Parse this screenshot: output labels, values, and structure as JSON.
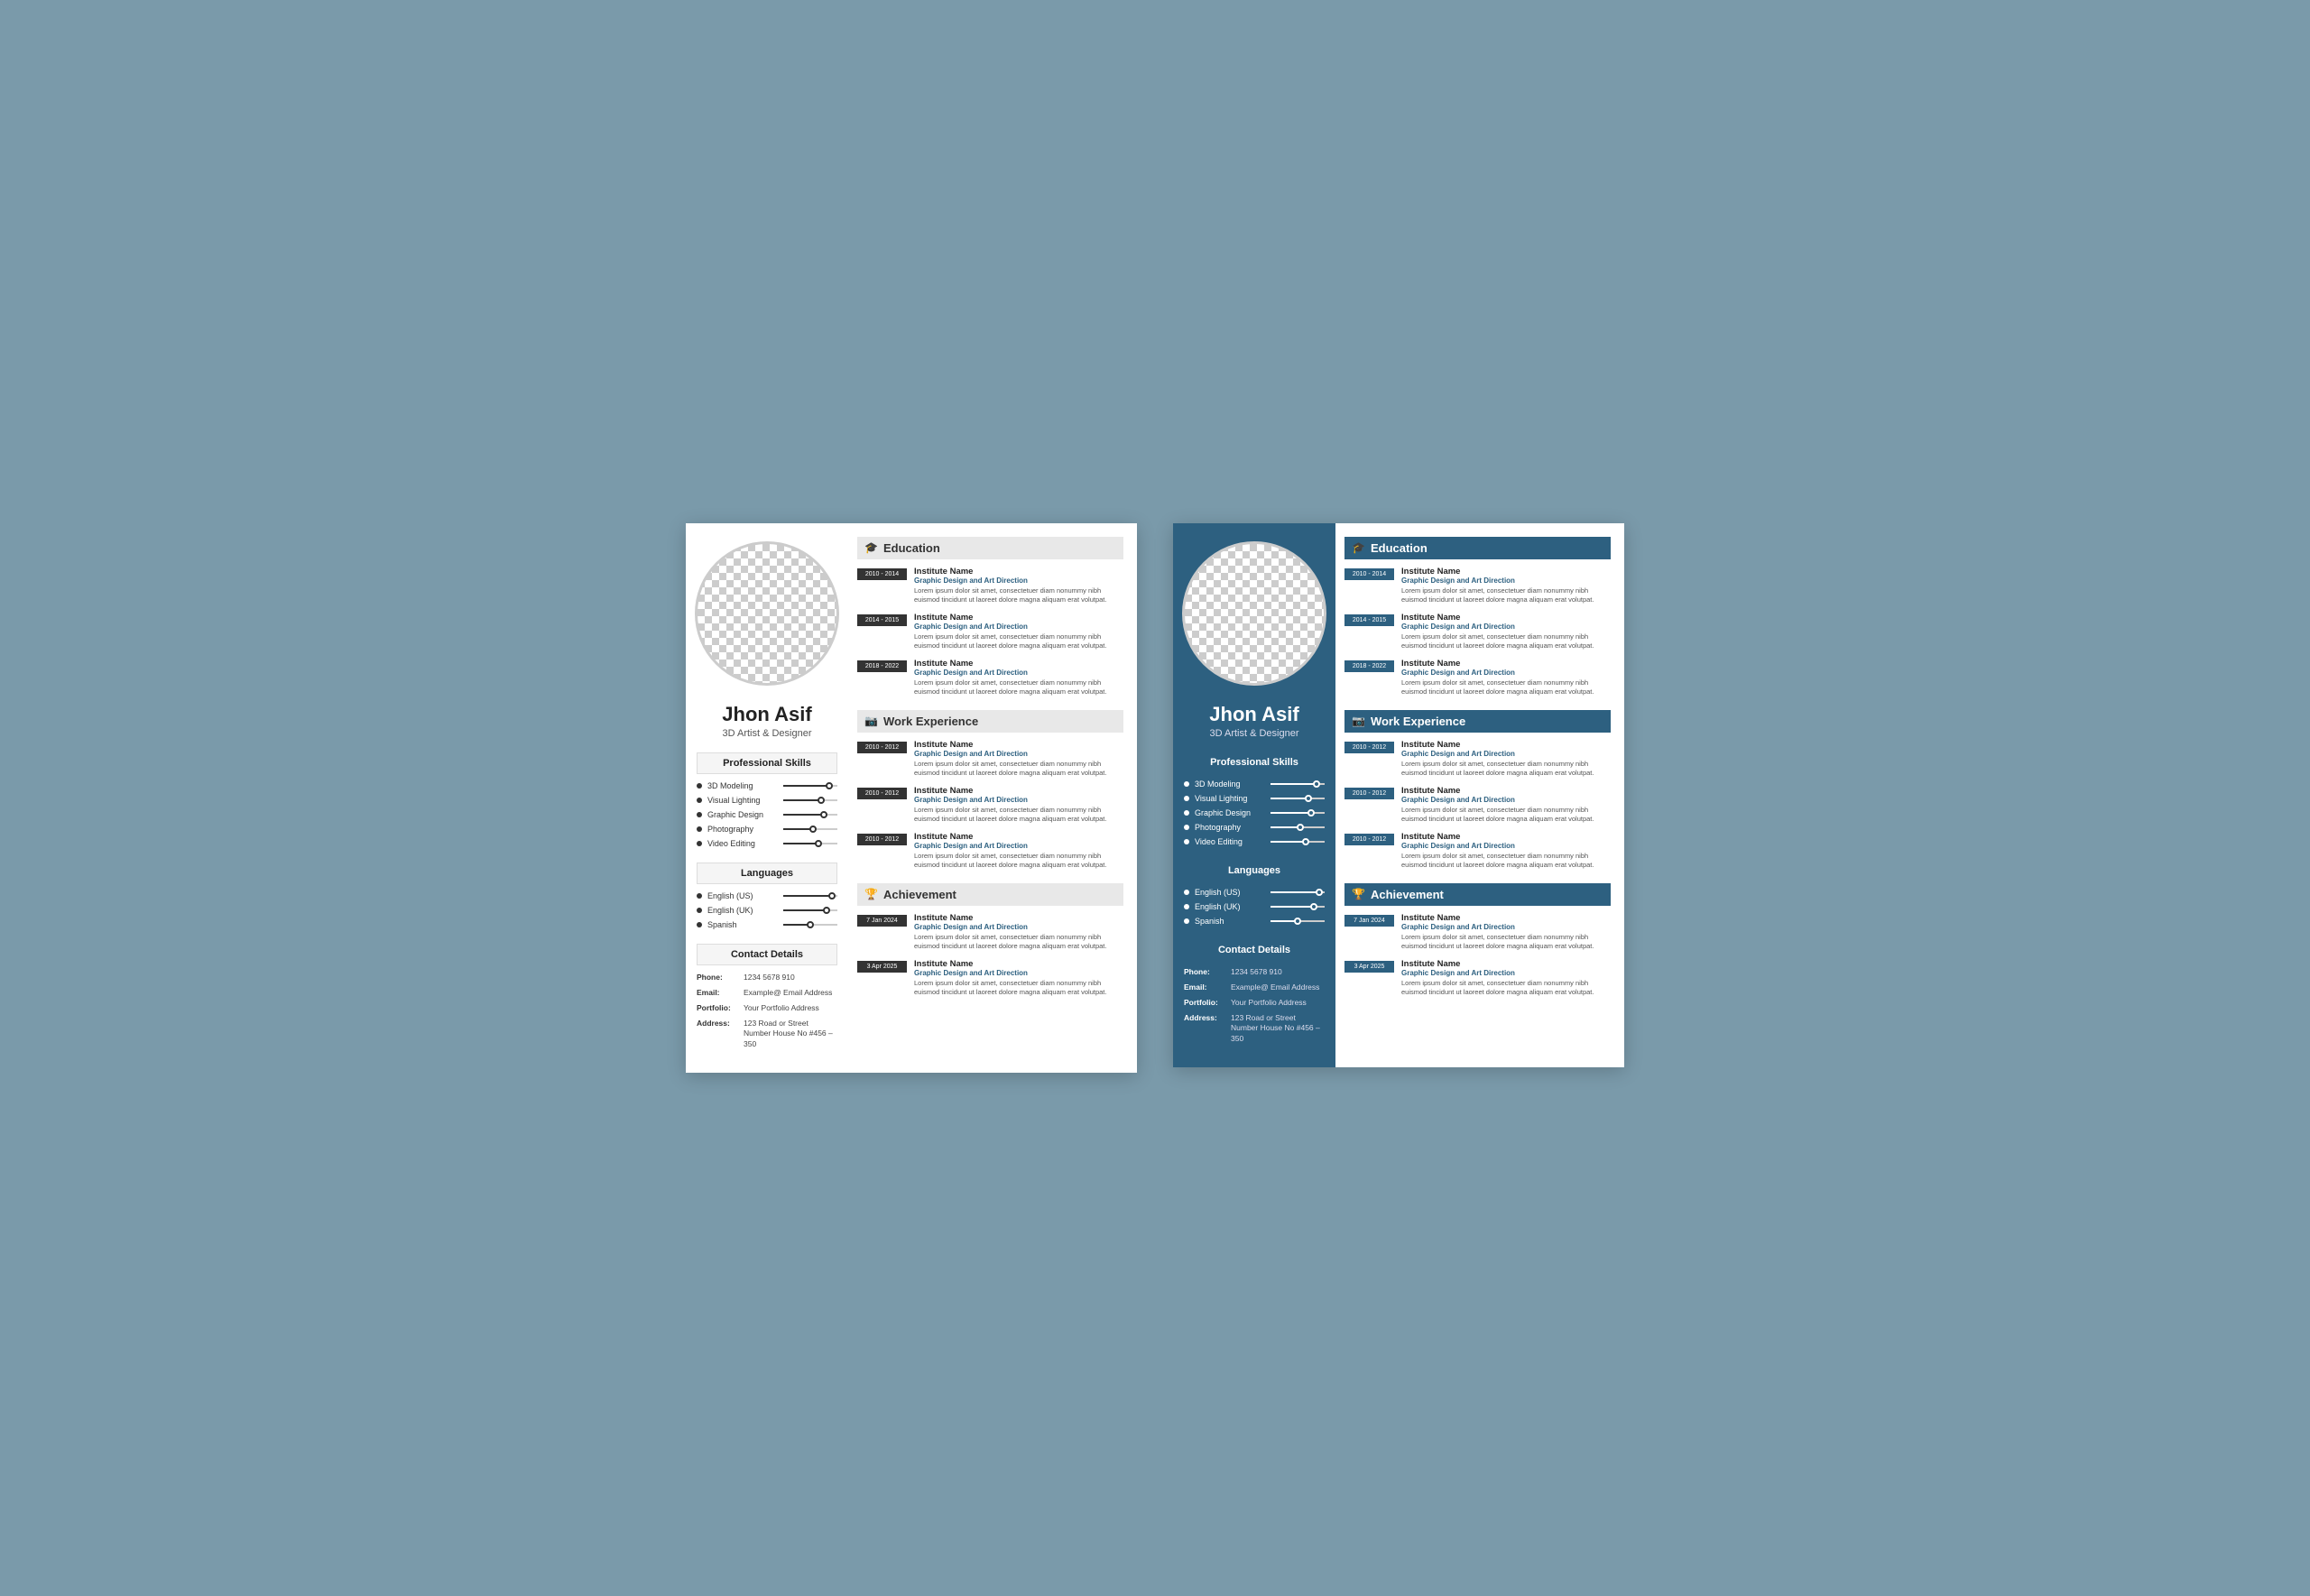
{
  "resumes": [
    {
      "id": "resume-white",
      "theme": "white",
      "name": "Jhon Asif",
      "title": "3D Artist & Designer",
      "skills_heading": "Professional Skills",
      "skills": [
        {
          "label": "3D Modeling",
          "level": 85
        },
        {
          "label": "Visual Lighting",
          "level": 70
        },
        {
          "label": "Graphic Design",
          "level": 75
        },
        {
          "label": "Photography",
          "level": 55
        },
        {
          "label": "Video Editing",
          "level": 65
        }
      ],
      "languages_heading": "Languages",
      "languages": [
        {
          "label": "English (US)",
          "level": 90
        },
        {
          "label": "English (UK)",
          "level": 80
        },
        {
          "label": "Spanish",
          "level": 50
        }
      ],
      "contact_heading": "Contact Details",
      "contact": [
        {
          "label": "Phone:",
          "value": "1234 5678 910"
        },
        {
          "label": "Email:",
          "value": "Example@ Email Address"
        },
        {
          "label": "Portfolio:",
          "value": "Your Portfolio Address"
        },
        {
          "label": "Address:",
          "value": "123 Road or Street Number House No #456 – 350"
        }
      ],
      "sections": [
        {
          "title": "Education",
          "icon": "🎓",
          "entries": [
            {
              "date": "2010 - 2014",
              "name": "Institute Name",
              "subtitle": "Graphic Design and Art Direction",
              "desc": "Lorem ipsum dolor sit amet, consectetuer diam nonummy nibh euismod tincidunt ut laoreet dolore magna aliquam erat volutpat."
            },
            {
              "date": "2014 - 2015",
              "name": "Institute Name",
              "subtitle": "Graphic Design and Art Direction",
              "desc": "Lorem ipsum dolor sit amet, consectetuer diam nonummy nibh euismod tincidunt ut laoreet dolore magna aliquam erat volutpat."
            },
            {
              "date": "2018 - 2022",
              "name": "Institute Name",
              "subtitle": "Graphic Design and Art Direction",
              "desc": "Lorem ipsum dolor sit amet, consectetuer diam nonummy nibh euismod tincidunt ut laoreet dolore magna aliquam erat volutpat."
            }
          ]
        },
        {
          "title": "Work Experience",
          "icon": "📷",
          "entries": [
            {
              "date": "2010 - 2012",
              "name": "Institute Name",
              "subtitle": "Graphic Design and Art Direction",
              "desc": "Lorem ipsum dolor sit amet, consectetuer diam nonummy nibh euismod tincidunt ut laoreet dolore magna aliquam erat volutpat."
            },
            {
              "date": "2010 - 2012",
              "name": "Institute Name",
              "subtitle": "Graphic Design and Art Direction",
              "desc": "Lorem ipsum dolor sit amet, consectetuer diam nonummy nibh euismod tincidunt ut laoreet dolore magna aliquam erat volutpat."
            },
            {
              "date": "2010 - 2012",
              "name": "Institute Name",
              "subtitle": "Graphic Design and Art Direction",
              "desc": "Lorem ipsum dolor sit amet, consectetuer diam nonummy nibh euismod tincidunt ut laoreet dolore magna aliquam erat volutpat."
            }
          ]
        },
        {
          "title": "Achievement",
          "icon": "🏆",
          "entries": [
            {
              "date": "7 Jan 2024",
              "name": "Institute Name",
              "subtitle": "Graphic Design and Art Direction",
              "desc": "Lorem ipsum dolor sit amet, consectetuer diam nonummy nibh euismod tincidunt ut laoreet dolore magna aliquam erat volutpat."
            },
            {
              "date": "3 Apr 2025",
              "name": "Institute Name",
              "subtitle": "Graphic Design and Art Direction",
              "desc": "Lorem ipsum dolor sit amet, consectetuer diam nonummy nibh euismod tincidunt ut laoreet dolore magna aliquam erat volutpat."
            }
          ]
        }
      ]
    },
    {
      "id": "resume-blue",
      "theme": "blue",
      "name": "Jhon Asif",
      "title": "3D Artist & Designer",
      "skills_heading": "Professional Skills",
      "skills": [
        {
          "label": "3D Modeling",
          "level": 85
        },
        {
          "label": "Visual Lighting",
          "level": 70
        },
        {
          "label": "Graphic Design",
          "level": 75
        },
        {
          "label": "Photography",
          "level": 55
        },
        {
          "label": "Video Editing",
          "level": 65
        }
      ],
      "languages_heading": "Languages",
      "languages": [
        {
          "label": "English (US)",
          "level": 90
        },
        {
          "label": "English (UK)",
          "level": 80
        },
        {
          "label": "Spanish",
          "level": 50
        }
      ],
      "contact_heading": "Contact Details",
      "contact": [
        {
          "label": "Phone:",
          "value": "1234 5678 910"
        },
        {
          "label": "Email:",
          "value": "Example@ Email Address"
        },
        {
          "label": "Portfolio:",
          "value": "Your Portfolio Address"
        },
        {
          "label": "Address:",
          "value": "123 Road or Street Number House No #456 – 350"
        }
      ],
      "sections": [
        {
          "title": "Education",
          "icon": "🎓",
          "entries": [
            {
              "date": "2010 - 2014",
              "name": "Institute Name",
              "subtitle": "Graphic Design and Art Direction",
              "desc": "Lorem ipsum dolor sit amet, consectetuer diam nonummy nibh euismod tincidunt ut laoreet dolore magna aliquam erat volutpat."
            },
            {
              "date": "2014 - 2015",
              "name": "Institute Name",
              "subtitle": "Graphic Design and Art Direction",
              "desc": "Lorem ipsum dolor sit amet, consectetuer diam nonummy nibh euismod tincidunt ut laoreet dolore magna aliquam erat volutpat."
            },
            {
              "date": "2018 - 2022",
              "name": "Institute Name",
              "subtitle": "Graphic Design and Art Direction",
              "desc": "Lorem ipsum dolor sit amet, consectetuer diam nonummy nibh euismod tincidunt ut laoreet dolore magna aliquam erat volutpat."
            }
          ]
        },
        {
          "title": "Work Experience",
          "icon": "📷",
          "entries": [
            {
              "date": "2010 - 2012",
              "name": "Institute Name",
              "subtitle": "Graphic Design and Art Direction",
              "desc": "Lorem ipsum dolor sit amet, consectetuer diam nonummy nibh euismod tincidunt ut laoreet dolore magna aliquam erat volutpat."
            },
            {
              "date": "2010 - 2012",
              "name": "Institute Name",
              "subtitle": "Graphic Design and Art Direction",
              "desc": "Lorem ipsum dolor sit amet, consectetuer diam nonummy nibh euismod tincidunt ut laoreet dolore magna aliquam erat volutpat."
            },
            {
              "date": "2010 - 2012",
              "name": "Institute Name",
              "subtitle": "Graphic Design and Art Direction",
              "desc": "Lorem ipsum dolor sit amet, consectetuer diam nonummy nibh euismod tincidunt ut laoreet dolore magna aliquam erat volutpat."
            }
          ]
        },
        {
          "title": "Achievement",
          "icon": "🏆",
          "entries": [
            {
              "date": "7 Jan 2024",
              "name": "Institute Name",
              "subtitle": "Graphic Design and Art Direction",
              "desc": "Lorem ipsum dolor sit amet, consectetuer diam nonummy nibh euismod tincidunt ut laoreet dolore magna aliquam erat volutpat."
            },
            {
              "date": "3 Apr 2025",
              "name": "Institute Name",
              "subtitle": "Graphic Design and Art Direction",
              "desc": "Lorem ipsum dolor sit amet, consectetuer diam nonummy nibh euismod tincidunt ut laoreet dolore magna aliquam erat volutpat."
            }
          ]
        }
      ]
    }
  ]
}
